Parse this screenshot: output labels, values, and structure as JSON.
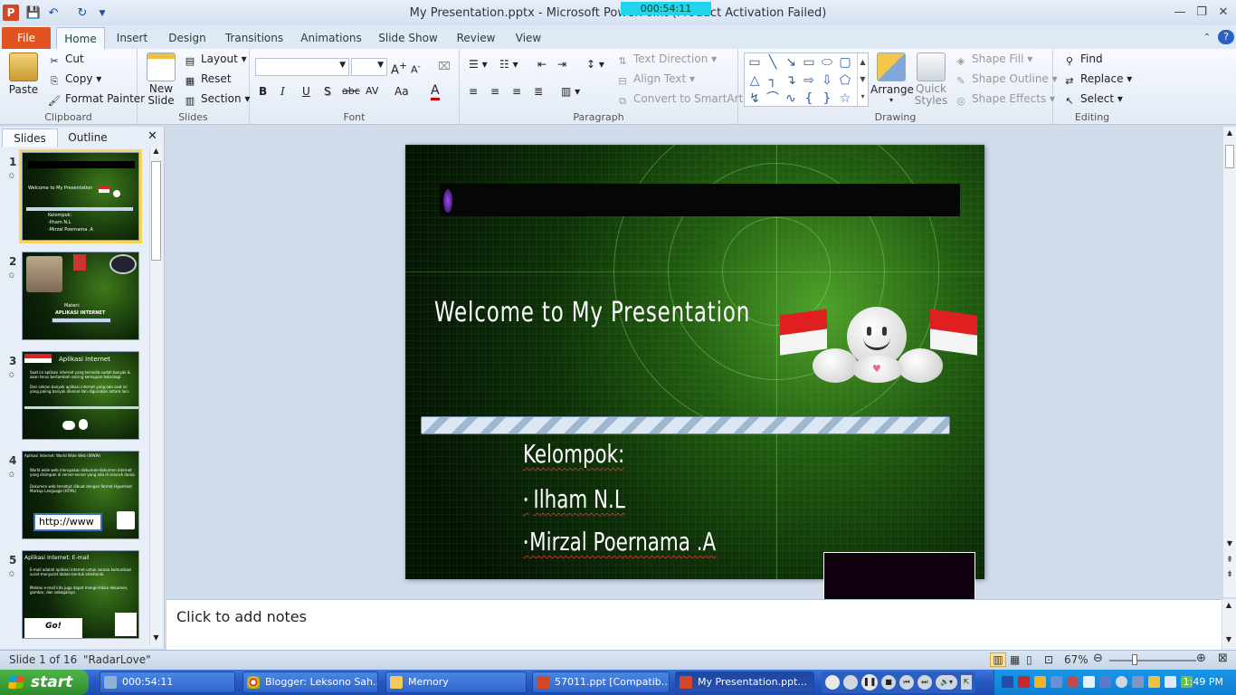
{
  "window": {
    "title": "My Presentation.pptx - Microsoft PowerPoint (Product Activation Failed)",
    "timer": "000:54:11",
    "app_icon": "P"
  },
  "tabs": [
    "File",
    "Home",
    "Insert",
    "Design",
    "Transitions",
    "Animations",
    "Slide Show",
    "Review",
    "View"
  ],
  "ribbon": {
    "clipboard": {
      "label": "Clipboard",
      "paste": "Paste",
      "cut": "Cut",
      "copy": "Copy",
      "format_painter": "Format Painter"
    },
    "slides": {
      "label": "Slides",
      "new_slide_1": "New",
      "new_slide_2": "Slide",
      "layout": "Layout",
      "reset": "Reset",
      "section": "Section"
    },
    "font": {
      "label": "Font",
      "bold": "B",
      "italic": "I",
      "underline": "U",
      "shadow": "S",
      "strike": "abc",
      "spacing": "AV",
      "case": "Aa",
      "color": "A"
    },
    "paragraph": {
      "label": "Paragraph",
      "text_direction": "Text Direction",
      "align_text": "Align Text",
      "convert_smartart": "Convert to SmartArt"
    },
    "drawing": {
      "label": "Drawing",
      "arrange": "Arrange",
      "quick_styles_1": "Quick",
      "quick_styles_2": "Styles",
      "shape_fill": "Shape Fill",
      "shape_outline": "Shape Outline",
      "shape_effects": "Shape Effects"
    },
    "editing": {
      "label": "Editing",
      "find": "Find",
      "replace": "Replace",
      "select": "Select"
    }
  },
  "side_panel": {
    "tabs": [
      "Slides",
      "Outline"
    ],
    "thumbnails": [
      {
        "num": "1",
        "lines": [
          "Welcome to My Presentation",
          "Kelompok:",
          "-Ilham N.L",
          "-Mirzal Poernama .A"
        ]
      },
      {
        "num": "2",
        "lines": [
          "Materi:",
          "APLIKASI INTERNET"
        ]
      },
      {
        "num": "3",
        "lines": [
          "Aplikasi Internet",
          "Saat ini aplikasi internet yang tersedia sudah banyak & akan terus bertambah seiring kemajuan teknologi.",
          "Dari sekian banyak aplikasi internet yang ada saat ini yang paling banyak dikenal dan digunakan antara lain:"
        ]
      },
      {
        "num": "4",
        "lines": [
          "Aplikasi Internet: World Wide Web (WWW)",
          "World wide web merupakan dokumen-dokumen internet yang disimpan di server-server yang ada di seluruh dunia.",
          "Dokumen web tersebut dibuat dengan format Hypertext Markup Language (HTML)",
          "http://www"
        ]
      },
      {
        "num": "5",
        "lines": [
          "Aplikasi Internet: E-mail",
          "E-mail adalah aplikasi internet untuk sarana komunikasi surat-menyurat dalam bentuk elektronik.",
          "Melalui e-mail kita juga dapat mengirimkan dokumen, gambar, dan sebagainya",
          "Go!"
        ]
      }
    ]
  },
  "slide": {
    "heading": "Welcome to My Presentation",
    "group_label": "Kelompok:",
    "member1": "Ilham N.L",
    "member2": "Mirzal Poernama .A",
    "bullet": "•"
  },
  "notes": {
    "placeholder": "Click to add notes"
  },
  "status": {
    "slide_info": "Slide 1 of 16",
    "theme": "\"RadarLove\"",
    "zoom": "67%"
  },
  "taskbar": {
    "start": "start",
    "items": [
      {
        "label": "000:54:11",
        "color": "#8fb0d8"
      },
      {
        "label": "Blogger: Leksono Sah...",
        "color": "#e9c53b"
      },
      {
        "label": "Memory",
        "color": "#f3c95b"
      },
      {
        "label": "57011.ppt [Compatib...",
        "color": "#d24726"
      },
      {
        "label": "My Presentation.ppt...",
        "color": "#d24726"
      }
    ],
    "clock": "1:49 PM"
  }
}
